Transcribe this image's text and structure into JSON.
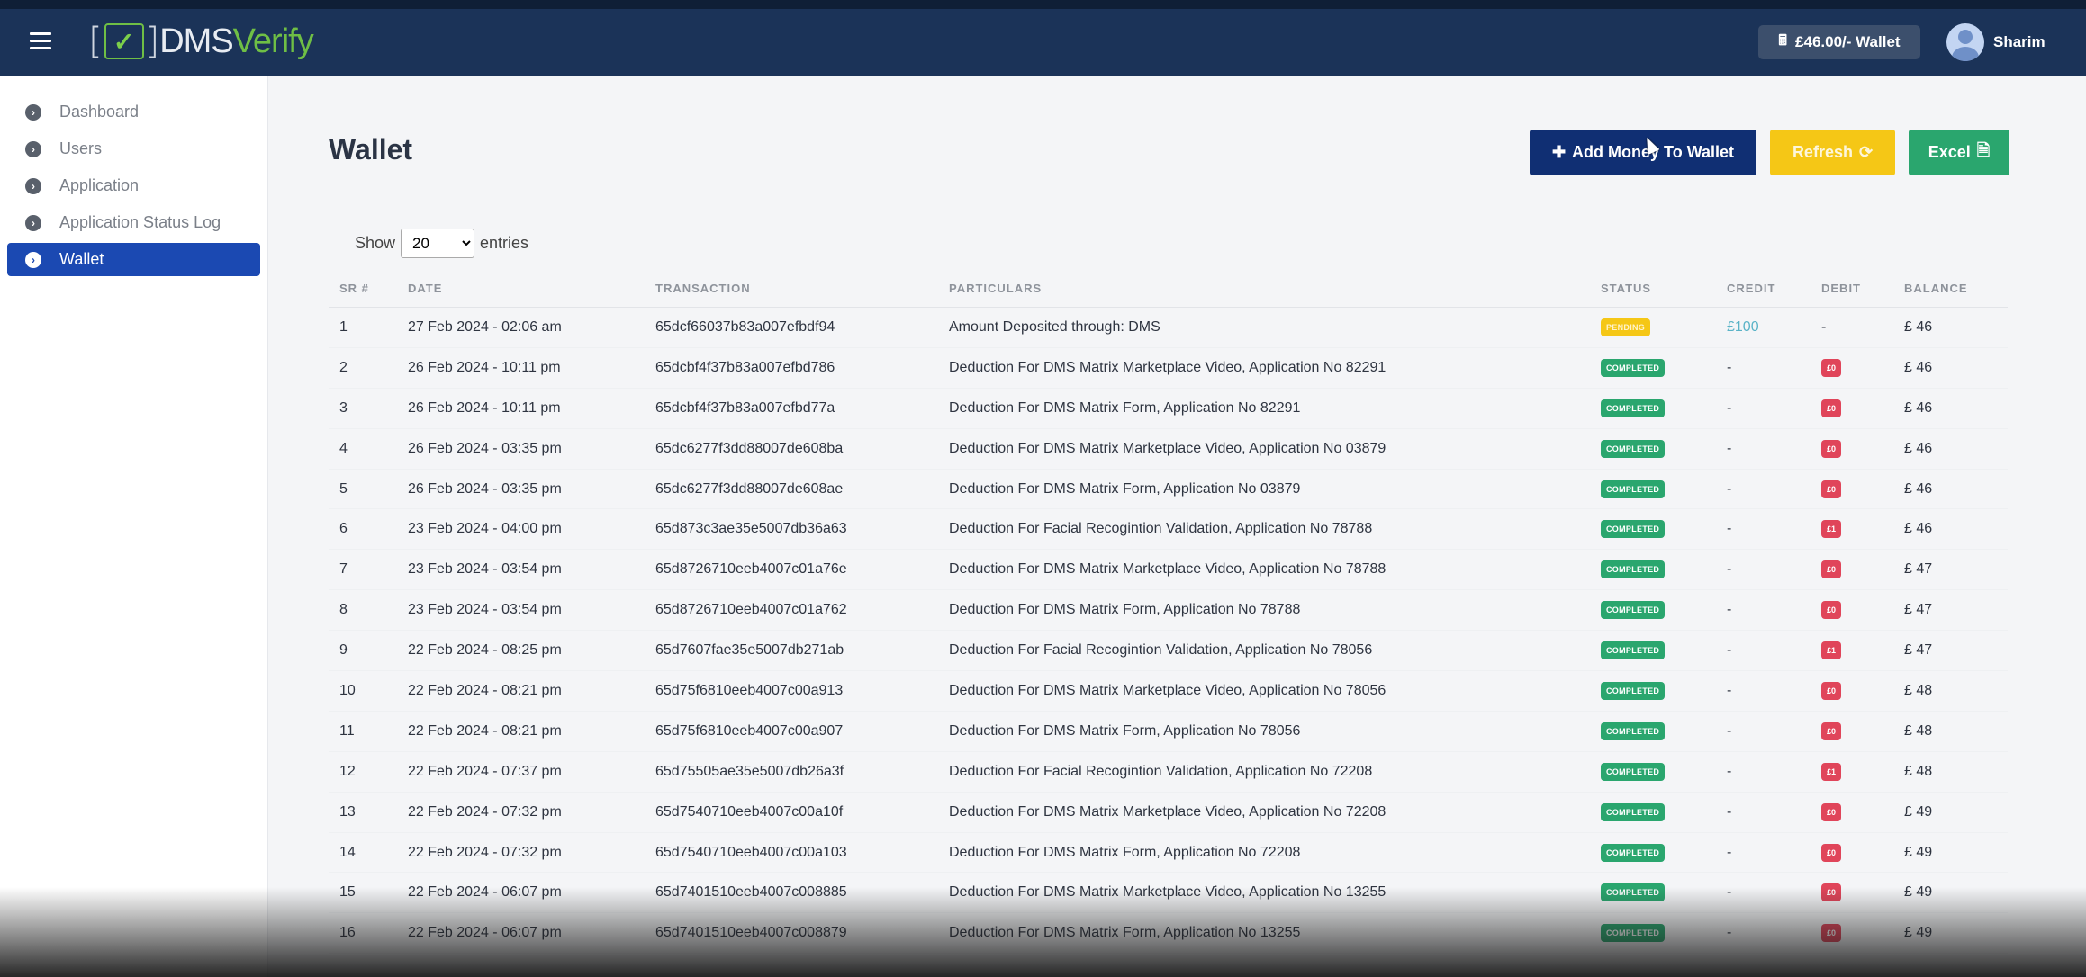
{
  "header": {
    "logo_dms": "DMS",
    "logo_verify": "Verify",
    "wallet_label": "£46.00/- Wallet",
    "user_name": "Sharim"
  },
  "sidebar": {
    "items": [
      {
        "label": "Dashboard"
      },
      {
        "label": "Users"
      },
      {
        "label": "Application"
      },
      {
        "label": "Application Status Log"
      },
      {
        "label": "Wallet"
      }
    ]
  },
  "page": {
    "title": "Wallet",
    "add_money_label": "Add Money To Wallet",
    "refresh_label": "Refresh",
    "excel_label": "Excel",
    "show_label": "Show",
    "entries_value": "20",
    "entries_label": "entries"
  },
  "table": {
    "headers": {
      "sr": "SR #",
      "date": "DATE",
      "transaction": "TRANSACTION",
      "particulars": "PARTICULARS",
      "status": "STATUS",
      "credit": "CREDIT",
      "debit": "DEBIT",
      "balance": "BALANCE"
    },
    "rows": [
      {
        "sr": "1",
        "date": "27 Feb 2024 - 02:06 am",
        "tx": "65dcf66037b83a007efbdf94",
        "part": "Amount Deposited through: DMS",
        "status": "PENDING",
        "credit": "£100",
        "debit": "-",
        "bal": "£ 46"
      },
      {
        "sr": "2",
        "date": "26 Feb 2024 - 10:11 pm",
        "tx": "65dcbf4f37b83a007efbd786",
        "part": "Deduction For DMS Matrix Marketplace Video, Application No 82291",
        "status": "COMPLETED",
        "credit": "-",
        "debit": "£0",
        "bal": "£ 46"
      },
      {
        "sr": "3",
        "date": "26 Feb 2024 - 10:11 pm",
        "tx": "65dcbf4f37b83a007efbd77a",
        "part": "Deduction For DMS Matrix Form, Application No 82291",
        "status": "COMPLETED",
        "credit": "-",
        "debit": "£0",
        "bal": "£ 46"
      },
      {
        "sr": "4",
        "date": "26 Feb 2024 - 03:35 pm",
        "tx": "65dc6277f3dd88007de608ba",
        "part": "Deduction For DMS Matrix Marketplace Video, Application No 03879",
        "status": "COMPLETED",
        "credit": "-",
        "debit": "£0",
        "bal": "£ 46"
      },
      {
        "sr": "5",
        "date": "26 Feb 2024 - 03:35 pm",
        "tx": "65dc6277f3dd88007de608ae",
        "part": "Deduction For DMS Matrix Form, Application No 03879",
        "status": "COMPLETED",
        "credit": "-",
        "debit": "£0",
        "bal": "£ 46"
      },
      {
        "sr": "6",
        "date": "23 Feb 2024 - 04:00 pm",
        "tx": "65d873c3ae35e5007db36a63",
        "part": "Deduction For Facial Recogintion Validation, Application No 78788",
        "status": "COMPLETED",
        "credit": "-",
        "debit": "£1",
        "bal": "£ 46"
      },
      {
        "sr": "7",
        "date": "23 Feb 2024 - 03:54 pm",
        "tx": "65d8726710eeb4007c01a76e",
        "part": "Deduction For DMS Matrix Marketplace Video, Application No 78788",
        "status": "COMPLETED",
        "credit": "-",
        "debit": "£0",
        "bal": "£ 47"
      },
      {
        "sr": "8",
        "date": "23 Feb 2024 - 03:54 pm",
        "tx": "65d8726710eeb4007c01a762",
        "part": "Deduction For DMS Matrix Form, Application No 78788",
        "status": "COMPLETED",
        "credit": "-",
        "debit": "£0",
        "bal": "£ 47"
      },
      {
        "sr": "9",
        "date": "22 Feb 2024 - 08:25 pm",
        "tx": "65d7607fae35e5007db271ab",
        "part": "Deduction For Facial Recogintion Validation, Application No 78056",
        "status": "COMPLETED",
        "credit": "-",
        "debit": "£1",
        "bal": "£ 47"
      },
      {
        "sr": "10",
        "date": "22 Feb 2024 - 08:21 pm",
        "tx": "65d75f6810eeb4007c00a913",
        "part": "Deduction For DMS Matrix Marketplace Video, Application No 78056",
        "status": "COMPLETED",
        "credit": "-",
        "debit": "£0",
        "bal": "£ 48"
      },
      {
        "sr": "11",
        "date": "22 Feb 2024 - 08:21 pm",
        "tx": "65d75f6810eeb4007c00a907",
        "part": "Deduction For DMS Matrix Form, Application No 78056",
        "status": "COMPLETED",
        "credit": "-",
        "debit": "£0",
        "bal": "£ 48"
      },
      {
        "sr": "12",
        "date": "22 Feb 2024 - 07:37 pm",
        "tx": "65d75505ae35e5007db26a3f",
        "part": "Deduction For Facial Recogintion Validation, Application No 72208",
        "status": "COMPLETED",
        "credit": "-",
        "debit": "£1",
        "bal": "£ 48"
      },
      {
        "sr": "13",
        "date": "22 Feb 2024 - 07:32 pm",
        "tx": "65d7540710eeb4007c00a10f",
        "part": "Deduction For DMS Matrix Marketplace Video, Application No 72208",
        "status": "COMPLETED",
        "credit": "-",
        "debit": "£0",
        "bal": "£ 49"
      },
      {
        "sr": "14",
        "date": "22 Feb 2024 - 07:32 pm",
        "tx": "65d7540710eeb4007c00a103",
        "part": "Deduction For DMS Matrix Form, Application No 72208",
        "status": "COMPLETED",
        "credit": "-",
        "debit": "£0",
        "bal": "£ 49"
      },
      {
        "sr": "15",
        "date": "22 Feb 2024 - 06:07 pm",
        "tx": "65d7401510eeb4007c008885",
        "part": "Deduction For DMS Matrix Marketplace Video, Application No 13255",
        "status": "COMPLETED",
        "credit": "-",
        "debit": "£0",
        "bal": "£ 49"
      },
      {
        "sr": "16",
        "date": "22 Feb 2024 - 06:07 pm",
        "tx": "65d7401510eeb4007c008879",
        "part": "Deduction For DMS Matrix Form, Application No 13255",
        "status": "COMPLETED",
        "credit": "-",
        "debit": "£0",
        "bal": "£ 49"
      }
    ]
  }
}
